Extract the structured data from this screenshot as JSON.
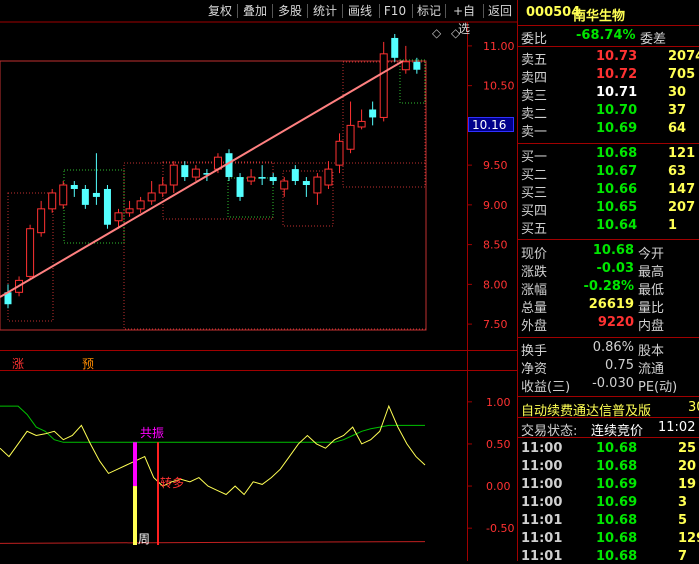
{
  "toolbar": {
    "buttons": [
      "复权",
      "叠加",
      "多股",
      "统计",
      "画线",
      "F10",
      "标记",
      "+自选",
      "返回"
    ]
  },
  "chart": {
    "price_labels": [
      "11.00",
      "10.50",
      "10.00",
      "9.50",
      "9.00",
      "8.50",
      "8.00",
      "7.50"
    ],
    "current_price_tag": "10.16",
    "diamond_1": "◇",
    "diamond_2": "◇",
    "marker_zhang": "涨",
    "marker_yu": "预",
    "ind_labels": [
      "1.00",
      "0.50",
      "0.00",
      "-0.50"
    ],
    "gongzhen": "共振",
    "zhuanduo": "转多",
    "zhou": "周",
    "colors": {
      "bull": "#ff3232",
      "bear": "#54ffff",
      "trend": "#ff8080",
      "yellow": "#ffff54",
      "green": "#00c000",
      "magenta": "#ff00ff"
    }
  },
  "quote": {
    "code": "000504",
    "name": "南华生物",
    "weibi_label": "委比",
    "weibi_value": "-68.74%",
    "weicha_label": "委差",
    "asks": [
      {
        "label": "卖五",
        "price": "10.73",
        "vol": "2074"
      },
      {
        "label": "卖四",
        "price": "10.72",
        "vol": "705"
      },
      {
        "label": "卖三",
        "price": "10.71",
        "vol": "30"
      },
      {
        "label": "卖二",
        "price": "10.70",
        "vol": "37"
      },
      {
        "label": "卖一",
        "price": "10.69",
        "vol": "64"
      }
    ],
    "bids": [
      {
        "label": "买一",
        "price": "10.68",
        "vol": "121"
      },
      {
        "label": "买二",
        "price": "10.67",
        "vol": "63"
      },
      {
        "label": "买三",
        "price": "10.66",
        "vol": "147"
      },
      {
        "label": "买四",
        "price": "10.65",
        "vol": "207"
      },
      {
        "label": "买五",
        "price": "10.64",
        "vol": "1"
      }
    ],
    "stats": [
      {
        "l1": "现价",
        "v1": "10.68",
        "l2": "今开"
      },
      {
        "l1": "涨跌",
        "v1": "-0.03",
        "l2": "最高"
      },
      {
        "l1": "涨幅",
        "v1": "-0.28%",
        "l2": "最低"
      },
      {
        "l1": "总量",
        "v1": "26619",
        "l2": "量比"
      },
      {
        "l1": "外盘",
        "v1": "9220",
        "l2": "内盘"
      }
    ],
    "stats2": [
      {
        "l1": "换手",
        "v1": "0.86%",
        "l2": "股本"
      },
      {
        "l1": "净资",
        "v1": "0.75",
        "l2": "流通"
      },
      {
        "l1": "收益(三)",
        "v1": "-0.030",
        "l2": "PE(动)"
      }
    ],
    "notice": "自动续费通达信普及版",
    "notice_tail": "30",
    "status_label": "交易状态:",
    "status_value": "连续竞价",
    "status_time": "11:02",
    "ticks": [
      {
        "t": "11:00",
        "p": "10.68",
        "v": "25"
      },
      {
        "t": "11:00",
        "p": "10.68",
        "v": "20"
      },
      {
        "t": "11:00",
        "p": "10.69",
        "v": "19"
      },
      {
        "t": "11:00",
        "p": "10.69",
        "v": "3"
      },
      {
        "t": "11:01",
        "p": "10.68",
        "v": "5"
      },
      {
        "t": "11:01",
        "p": "10.68",
        "v": "129"
      },
      {
        "t": "11:01",
        "p": "10.68",
        "v": "7"
      }
    ]
  },
  "chart_data": {
    "type": "candlestick",
    "ylim": [
      7.3,
      11.2
    ],
    "candles": [
      {
        "o": 7.9,
        "c": 7.75,
        "h": 8.0,
        "l": 7.7
      },
      {
        "o": 7.9,
        "c": 8.05,
        "h": 8.1,
        "l": 7.85
      },
      {
        "o": 8.1,
        "c": 8.7,
        "h": 8.75,
        "l": 8.05
      },
      {
        "o": 8.65,
        "c": 8.95,
        "h": 9.05,
        "l": 8.6
      },
      {
        "o": 8.95,
        "c": 9.15,
        "h": 9.2,
        "l": 8.9
      },
      {
        "o": 9.0,
        "c": 9.25,
        "h": 9.3,
        "l": 8.95
      },
      {
        "o": 9.25,
        "c": 9.2,
        "h": 9.3,
        "l": 9.1
      },
      {
        "o": 9.2,
        "c": 9.0,
        "h": 9.25,
        "l": 8.95
      },
      {
        "o": 9.15,
        "c": 9.1,
        "h": 9.65,
        "l": 9.0
      },
      {
        "o": 9.2,
        "c": 8.75,
        "h": 9.25,
        "l": 8.7
      },
      {
        "o": 8.8,
        "c": 8.9,
        "h": 8.95,
        "l": 8.7
      },
      {
        "o": 8.9,
        "c": 8.95,
        "h": 9.05,
        "l": 8.85
      },
      {
        "o": 8.95,
        "c": 9.05,
        "h": 9.1,
        "l": 8.9
      },
      {
        "o": 9.05,
        "c": 9.15,
        "h": 9.3,
        "l": 9.0
      },
      {
        "o": 9.15,
        "c": 9.25,
        "h": 9.35,
        "l": 9.1
      },
      {
        "o": 9.25,
        "c": 9.5,
        "h": 9.55,
        "l": 9.15
      },
      {
        "o": 9.5,
        "c": 9.35,
        "h": 9.55,
        "l": 9.3
      },
      {
        "o": 9.35,
        "c": 9.45,
        "h": 9.5,
        "l": 9.3
      },
      {
        "o": 9.4,
        "c": 9.38,
        "h": 9.45,
        "l": 9.3
      },
      {
        "o": 9.45,
        "c": 9.6,
        "h": 9.65,
        "l": 9.4
      },
      {
        "o": 9.65,
        "c": 9.35,
        "h": 9.7,
        "l": 9.3
      },
      {
        "o": 9.35,
        "c": 9.1,
        "h": 9.4,
        "l": 9.05
      },
      {
        "o": 9.3,
        "c": 9.35,
        "h": 9.45,
        "l": 9.25
      },
      {
        "o": 9.35,
        "c": 9.33,
        "h": 9.5,
        "l": 9.25
      },
      {
        "o": 9.35,
        "c": 9.3,
        "h": 9.4,
        "l": 9.25
      },
      {
        "o": 9.2,
        "c": 9.3,
        "h": 9.35,
        "l": 9.1
      },
      {
        "o": 9.45,
        "c": 9.3,
        "h": 9.5,
        "l": 9.25
      },
      {
        "o": 9.3,
        "c": 9.25,
        "h": 9.35,
        "l": 9.1
      },
      {
        "o": 9.15,
        "c": 9.35,
        "h": 9.4,
        "l": 9.0
      },
      {
        "o": 9.25,
        "c": 9.45,
        "h": 9.55,
        "l": 9.2
      },
      {
        "o": 9.5,
        "c": 9.8,
        "h": 9.9,
        "l": 9.4
      },
      {
        "o": 9.7,
        "c": 10.0,
        "h": 10.3,
        "l": 9.65
      },
      {
        "o": 9.98,
        "c": 10.05,
        "h": 10.2,
        "l": 9.95
      },
      {
        "o": 10.2,
        "c": 10.1,
        "h": 10.3,
        "l": 10.0
      },
      {
        "o": 10.1,
        "c": 10.9,
        "h": 11.05,
        "l": 10.05
      },
      {
        "o": 11.1,
        "c": 10.85,
        "h": 11.15,
        "l": 10.8
      },
      {
        "o": 10.7,
        "c": 10.8,
        "h": 11.0,
        "l": 10.65
      },
      {
        "o": 10.8,
        "c": 10.7,
        "h": 10.85,
        "l": 10.65
      }
    ],
    "indicator": {
      "ylim": [
        -0.7,
        1.2
      ],
      "yellow": [
        0.45,
        0.35,
        0.5,
        0.65,
        0.6,
        0.62,
        0.65,
        0.55,
        0.6,
        0.72,
        0.5,
        0.3,
        0.15,
        0.2,
        0.25,
        0.3,
        0.35,
        0.1,
        0.0,
        0.05,
        0.08,
        0.05,
        0.1,
        0.0,
        -0.05,
        -0.1,
        0.0,
        -0.1,
        0.05,
        0.02,
        0.1,
        0.2,
        0.35,
        0.5,
        0.6,
        0.5,
        0.45,
        0.55,
        0.6,
        0.7,
        0.5,
        0.55,
        0.65,
        0.95,
        0.7,
        0.5,
        0.35,
        0.25
      ],
      "green": [
        0.95,
        0.95,
        0.95,
        0.85,
        0.7,
        0.65,
        0.55,
        0.52,
        0.52,
        0.52,
        0.52,
        0.52,
        0.52,
        0.52,
        0.52,
        0.52,
        0.52,
        0.52,
        0.52,
        0.52,
        0.52,
        0.52,
        0.52,
        0.52,
        0.52,
        0.52,
        0.52,
        0.52,
        0.52,
        0.52,
        0.52,
        0.52,
        0.52,
        0.52,
        0.52,
        0.52,
        0.52,
        0.52,
        0.55,
        0.6,
        0.65,
        0.68,
        0.7,
        0.72,
        0.72,
        0.72,
        0.72,
        0.72
      ]
    }
  }
}
